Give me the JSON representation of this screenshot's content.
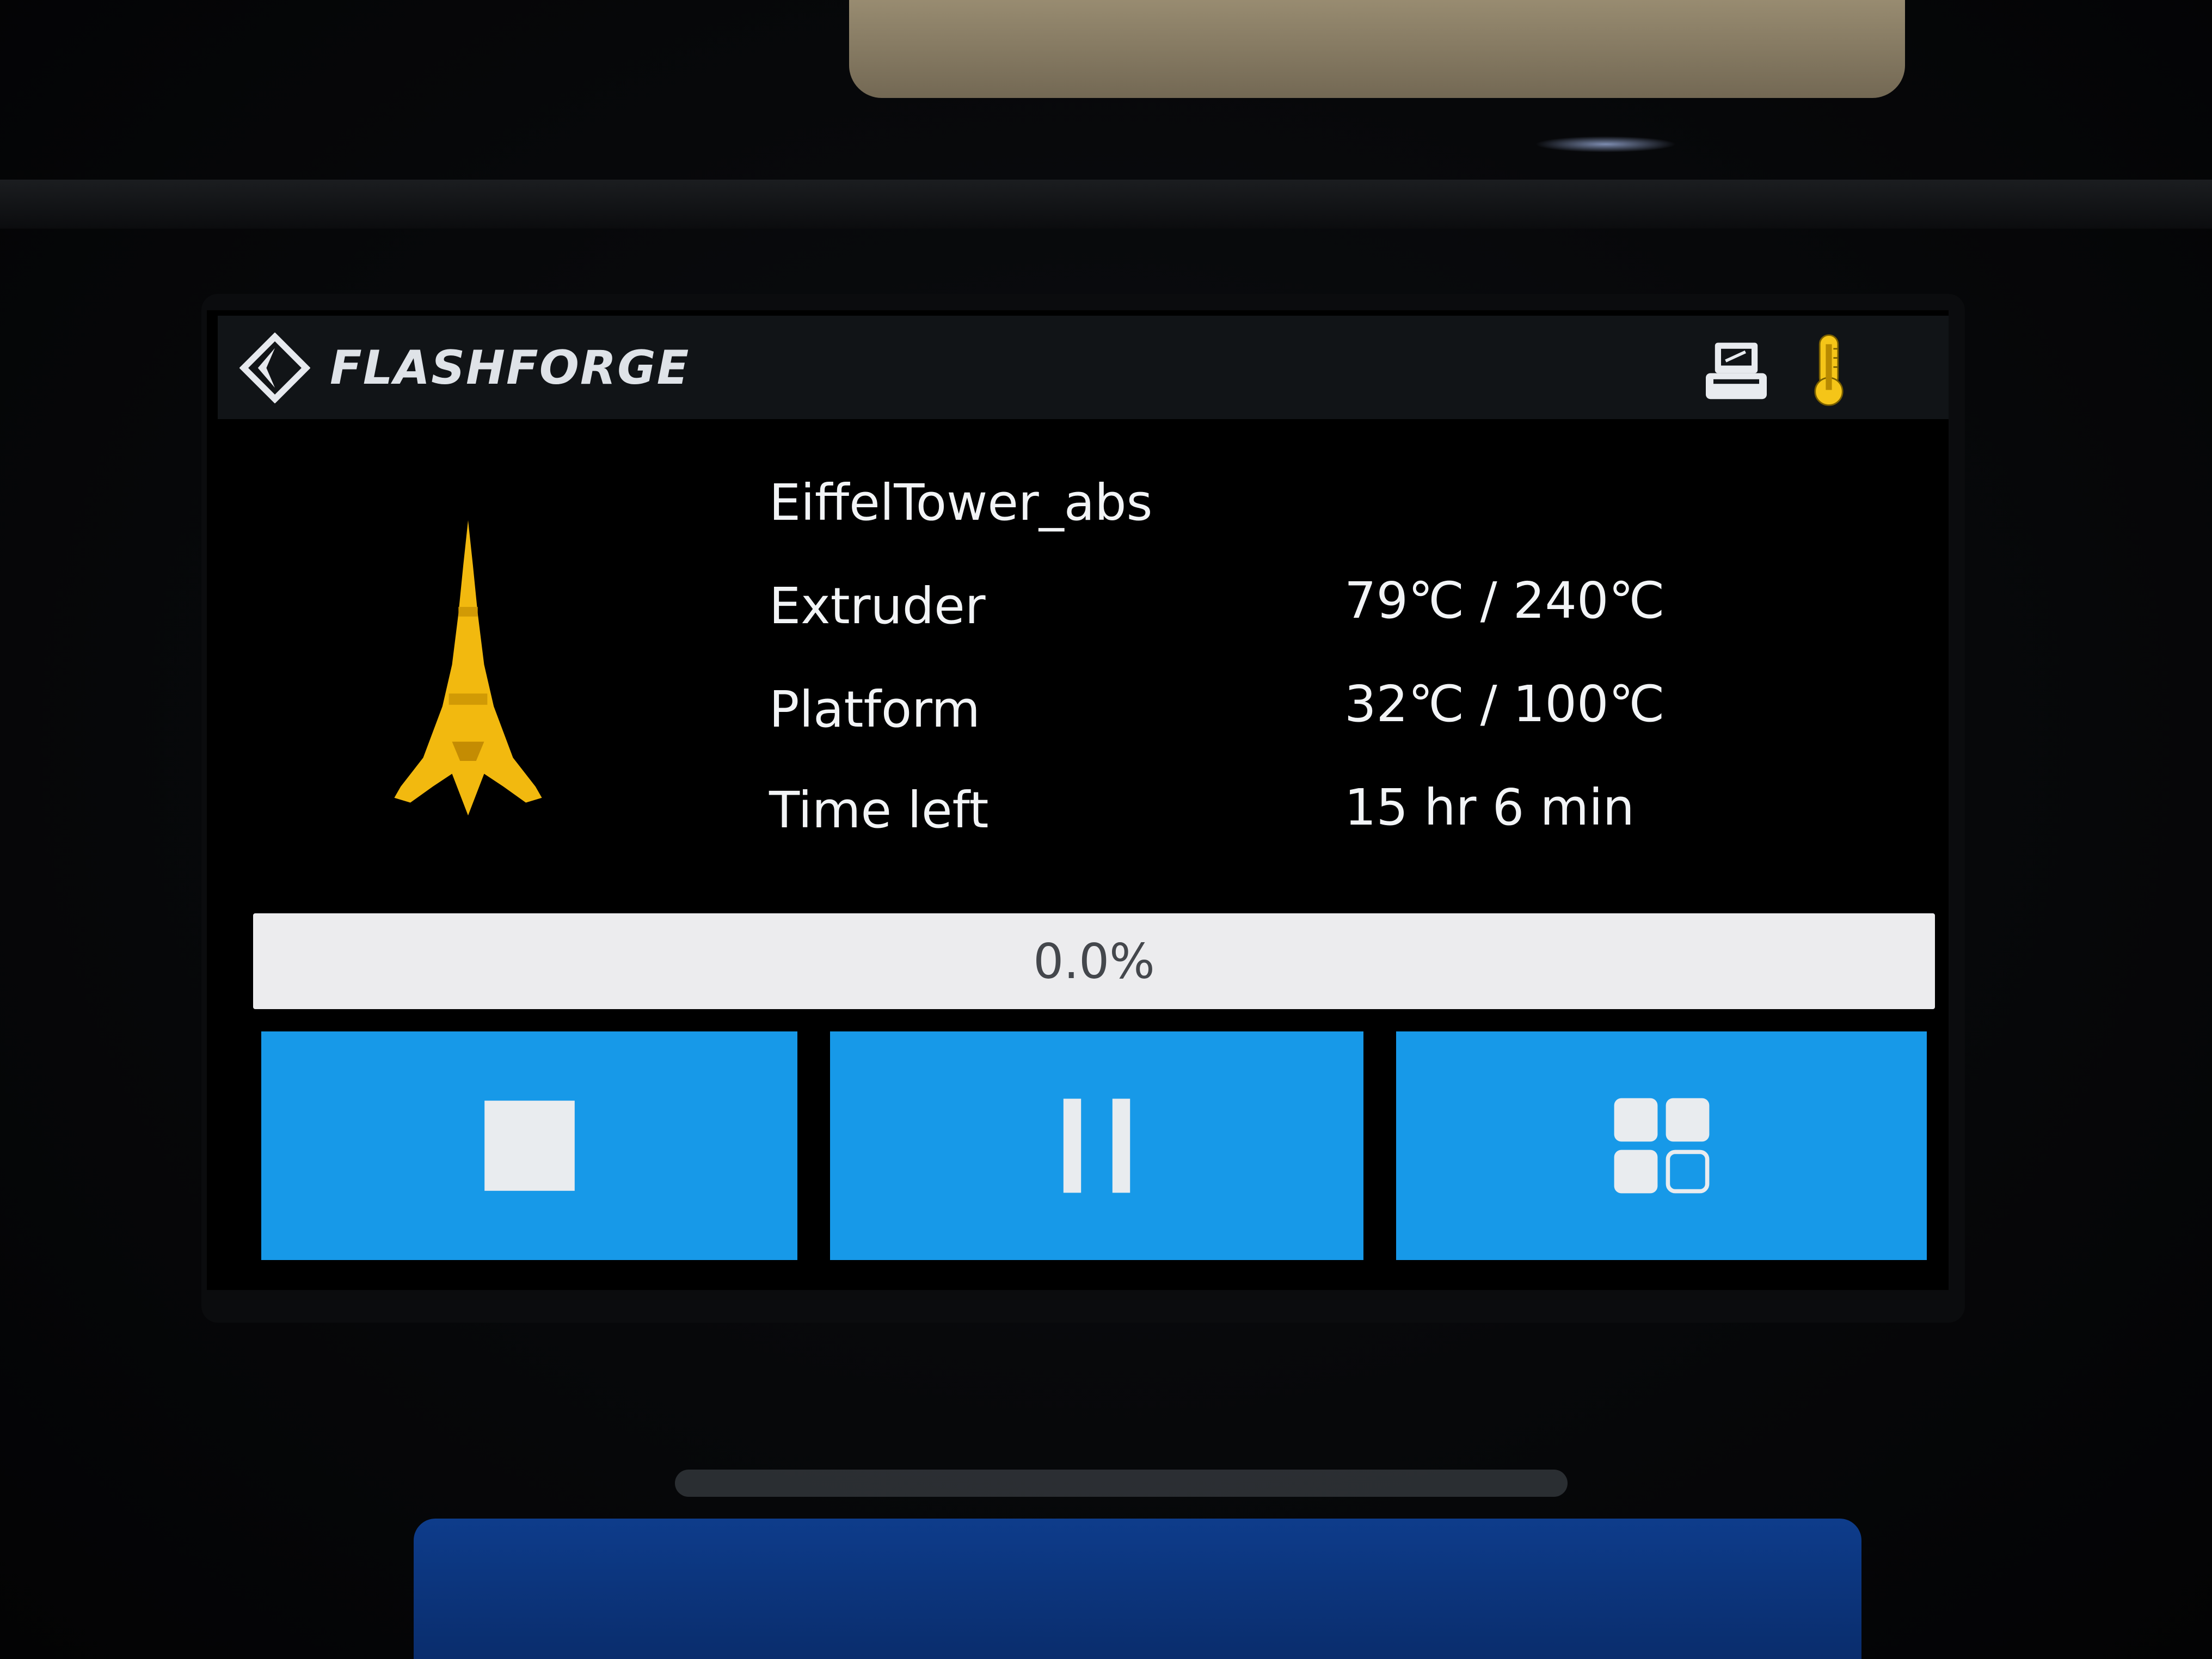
{
  "header": {
    "brand": "FLASHFORGE",
    "logo_icon": "flashforge-diamond-logo",
    "status_icons": [
      "printer-icon",
      "thermometer-icon"
    ]
  },
  "job": {
    "file_name": "EiffelTower_abs",
    "thumbnail": "eiffel-tower-model-preview"
  },
  "status": {
    "extruder_label": "Extruder",
    "extruder_value": "79℃ / 240℃",
    "platform_label": "Platform",
    "platform_value": "32℃ / 100℃",
    "time_left_label": "Time left",
    "time_left_value": "15 hr 6 min"
  },
  "progress": {
    "text": "0.0%",
    "fraction": 0.0
  },
  "controls": {
    "stop_icon": "stop-icon",
    "pause_icon": "pause-icon",
    "menu_icon": "menu-grid-icon"
  },
  "colors": {
    "button_blue": "#1799e8",
    "thumbnail_yellow": "#f2b90f",
    "thermometer_yellow": "#f5c518",
    "screen_bg": "#000000",
    "header_bg": "#111417"
  }
}
